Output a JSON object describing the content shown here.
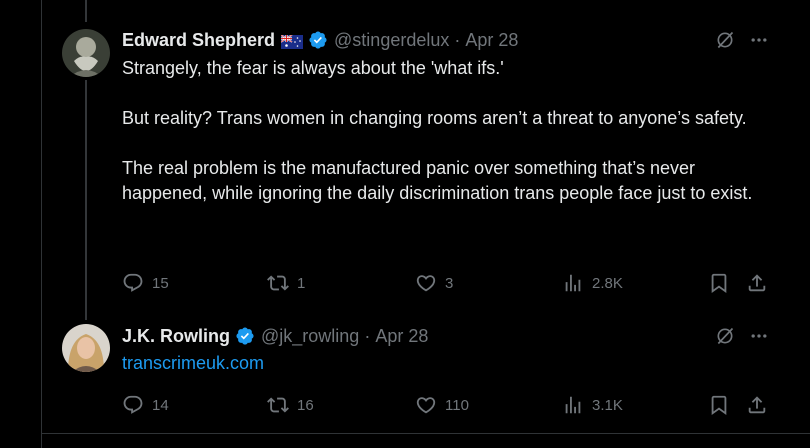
{
  "colors": {
    "background": "#000000",
    "text": "#e7e9ea",
    "muted": "#71767b",
    "link": "#1d9bf0",
    "verified": "#1d9bf0"
  },
  "tweets": [
    {
      "author_name": "Edward Shepherd",
      "flag_icon": "australia-flag-icon",
      "verified": true,
      "handle": "@stingerdelux",
      "separator": "·",
      "date": "Apr 28",
      "paragraphs": [
        "Strangely, the fear is always about the 'what ifs.'",
        "But reality? Trans women in changing rooms aren’t a threat to anyone’s safety.",
        "The real problem is the manufactured panic over something that’s never happened, while ignoring the daily discrimination trans people face just to exist."
      ],
      "actions": {
        "replies": "15",
        "reposts": "1",
        "likes": "3",
        "views": "2.8K"
      }
    },
    {
      "author_name": "J.K. Rowling",
      "verified": true,
      "handle": "@jk_rowling",
      "separator": "·",
      "date": "Apr 28",
      "link": "transcrimeuk.com",
      "actions": {
        "replies": "14",
        "reposts": "16",
        "likes": "110",
        "views": "3.1K"
      }
    }
  ],
  "icons": [
    "grok-icon",
    "more-icon",
    "reply-icon",
    "repost-icon",
    "like-icon",
    "views-icon",
    "bookmark-icon",
    "share-icon"
  ]
}
